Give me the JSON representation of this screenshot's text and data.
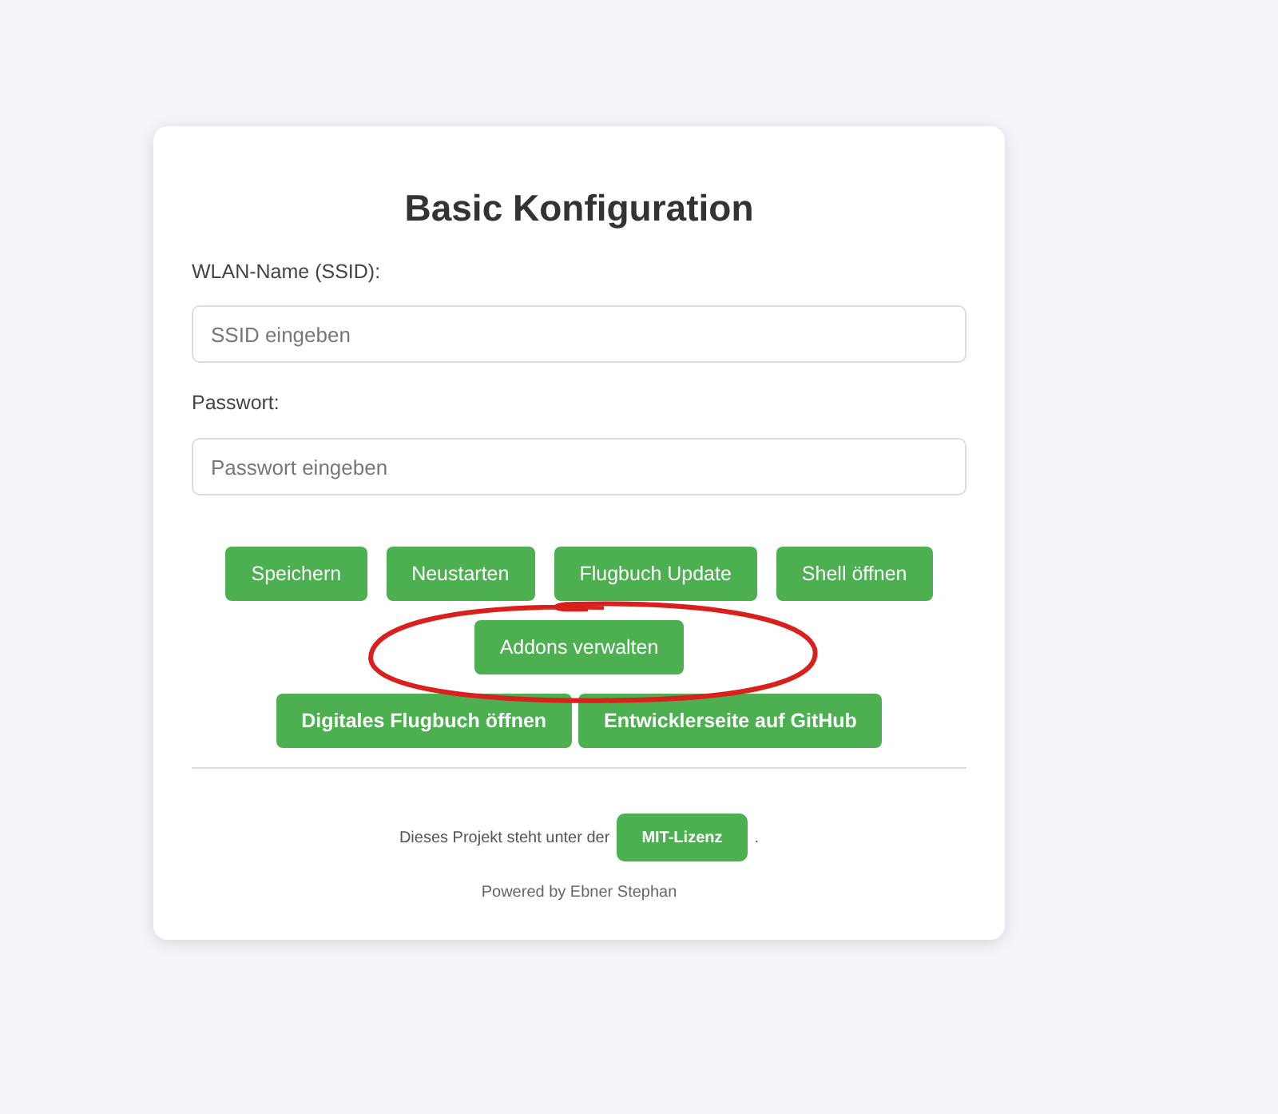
{
  "title": "Basic Konfiguration",
  "fields": [
    {
      "label": "WLAN-Name (SSID):",
      "placeholder": "SSID eingeben"
    },
    {
      "label": "Passwort:",
      "placeholder": "Passwort eingeben"
    }
  ],
  "button_rows": [
    [
      "Speichern",
      "Neustarten",
      "Flugbuch Update",
      "Shell öffnen"
    ],
    [
      "Addons verwalten"
    ],
    [
      "Digitales Flugbuch öffnen",
      "Entwicklerseite auf GitHub"
    ]
  ],
  "footer": {
    "text_before": "Dieses Projekt steht unter der",
    "link_label": "MIT-Lizenz",
    "text_after": ".",
    "credit": "Powered by Ebner Stephan"
  }
}
